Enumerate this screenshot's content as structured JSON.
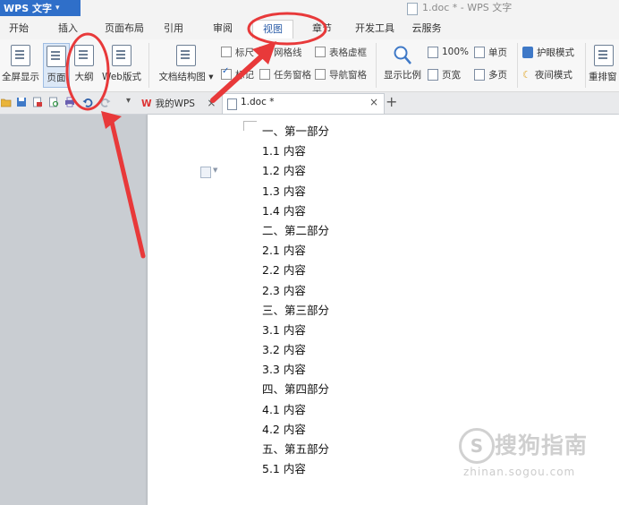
{
  "titlebar": {
    "app_name": "WPS 文字",
    "app_menu_arrow": "▾",
    "document_title": "1.doc * - WPS 文字"
  },
  "menu": {
    "tabs": [
      "开始",
      "插入",
      "页面布局",
      "引用",
      "审阅",
      "视图",
      "章节",
      "开发工具",
      "云服务"
    ],
    "active_tab": "视图"
  },
  "ribbon": {
    "view_buttons": [
      "全屏显示",
      "页面",
      "大纲",
      "Web版式"
    ],
    "selected_view": "页面",
    "doc_structure": "文档结构图",
    "doc_structure_arrow": "▾",
    "checkboxes": [
      {
        "label": "标尺",
        "checked": false
      },
      {
        "label": "网格线",
        "checked": false
      },
      {
        "label": "表格虚框",
        "checked": false
      },
      {
        "label": "标记",
        "checked": true
      },
      {
        "label": "任务窗格",
        "checked": false
      },
      {
        "label": "导航窗格",
        "checked": false
      }
    ],
    "zoom_button": "显示比例",
    "zoom_percent": "100%",
    "page_width": "页宽",
    "single_page": "单页",
    "multi_page": "多页",
    "eye_mode": "护眼模式",
    "night_mode": "夜间模式",
    "rearrange": "重排窗"
  },
  "tabsbar": {
    "home_tab": "我的WPS",
    "doc_tab": "1.doc *",
    "close_glyph": "×",
    "new_tab_glyph": "+",
    "more_glyph": "▾"
  },
  "document": {
    "lines": [
      "一、第一部分",
      "1.1 内容",
      "1.2 内容",
      "1.3 内容",
      "1.4 内容",
      "二、第二部分",
      "2.1 内容",
      "2.2 内容",
      "2.3 内容",
      "三、第三部分",
      "3.1 内容",
      "3.2 内容",
      "3.3 内容",
      "四、第四部分",
      "4.1 内容",
      "4.2 内容",
      "五、第五部分",
      "5.1 内容"
    ]
  },
  "watermark": {
    "symbol": "S",
    "text": "搜狗指南",
    "url": "zhinan.sogou.com"
  },
  "colors": {
    "accent": "#2f6fc9",
    "annotation": "#e8393a"
  }
}
